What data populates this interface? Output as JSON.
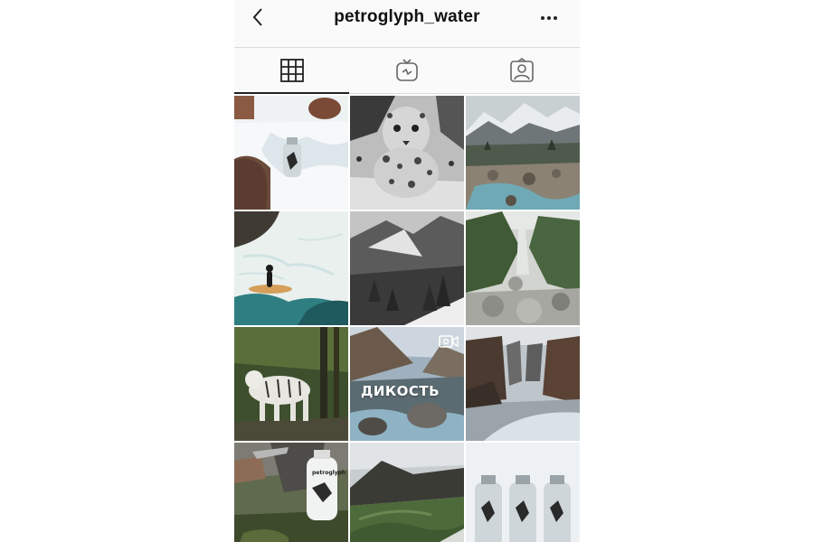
{
  "header": {
    "username": "petroglyph_water",
    "back_icon": "chevron-left-icon",
    "more_icon": "more-horizontal-icon"
  },
  "tabs": [
    {
      "icon": "grid-icon",
      "active": true
    },
    {
      "icon": "igtv-icon",
      "active": false
    },
    {
      "icon": "tagged-icon",
      "active": false
    }
  ],
  "posts": [
    {
      "subject": "bottle on snowy rocks"
    },
    {
      "subject": "snow leopard"
    },
    {
      "subject": "mountain river"
    },
    {
      "subject": "surfer in waves"
    },
    {
      "subject": "snowy forest valley"
    },
    {
      "subject": "rocky mountain stream"
    },
    {
      "subject": "white tiger"
    },
    {
      "subject": "canyon overlay",
      "overlay_text": "ДИКОСТЬ",
      "video": true
    },
    {
      "subject": "canyon river"
    },
    {
      "subject": "hands with bottle",
      "bottle_label": "petroglyph"
    },
    {
      "subject": "green valley"
    },
    {
      "subject": "three bottles"
    }
  ],
  "colors": {
    "header_bg": "#fafafa",
    "divider": "#dbdbdb",
    "text": "#111111"
  }
}
